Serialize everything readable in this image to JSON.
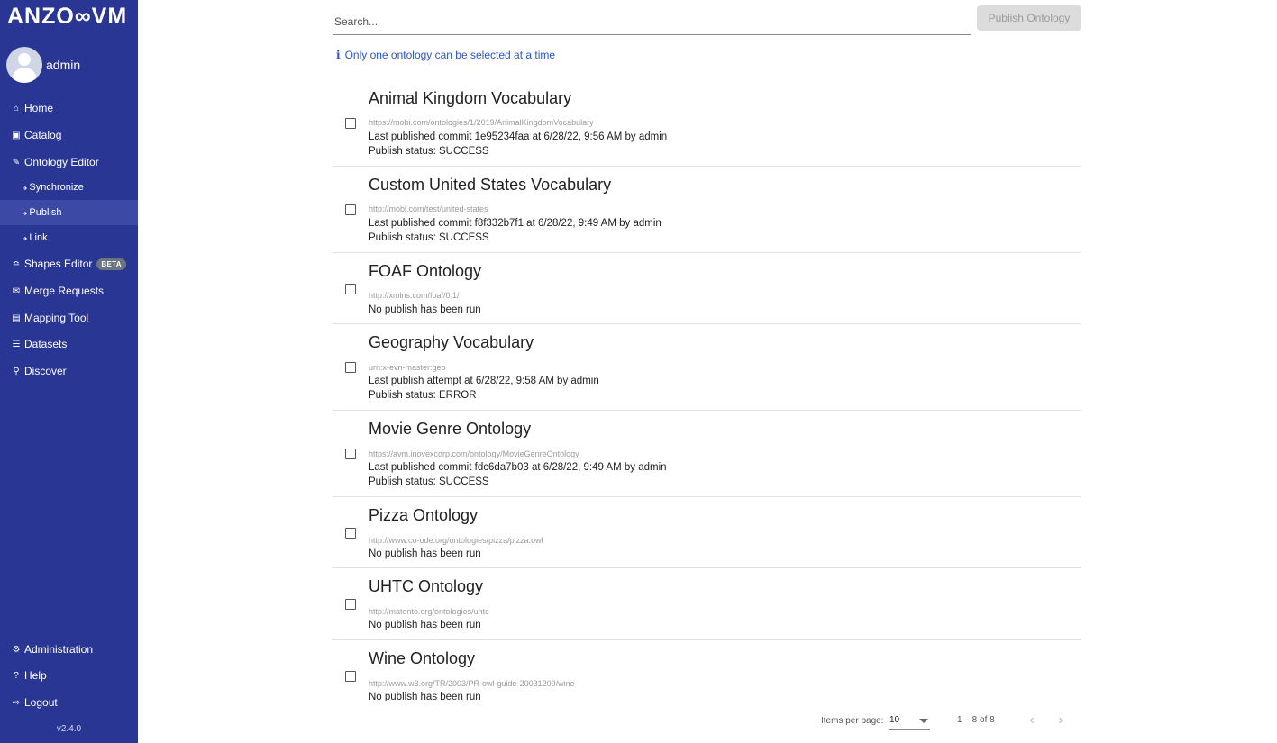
{
  "app": {
    "logo_text": "ANZO∞VM",
    "username": "admin",
    "version": "v2.4.0"
  },
  "nav": {
    "home": {
      "icon": "home-icon",
      "label": "Home"
    },
    "catalog": {
      "icon": "book-icon",
      "label": "Catalog"
    },
    "ontology_editor": {
      "icon": "edit-icon",
      "label": "Ontology Editor"
    },
    "synchronize": {
      "icon": "subitem-arrow-icon",
      "label": "Synchronize"
    },
    "publish": {
      "icon": "subitem-arrow-icon",
      "label": "Publish"
    },
    "link": {
      "icon": "subitem-arrow-icon",
      "label": "Link"
    },
    "shapes_editor": {
      "icon": "shapes-icon",
      "label": "Shapes Editor",
      "badge": "BETA"
    },
    "merge_requests": {
      "icon": "envelope-icon",
      "label": "Merge Requests"
    },
    "mapping_tool": {
      "icon": "map-icon",
      "label": "Mapping Tool"
    },
    "datasets": {
      "icon": "database-icon",
      "label": "Datasets"
    },
    "discover": {
      "icon": "search-icon",
      "label": "Discover"
    },
    "administration": {
      "icon": "gear-icon",
      "label": "Administration"
    },
    "help": {
      "icon": "question-icon",
      "label": "Help"
    },
    "logout": {
      "icon": "sign-out-icon",
      "label": "Logout"
    }
  },
  "toolbar": {
    "search_placeholder": "Search...",
    "publish_label": "Publish Ontology"
  },
  "info": {
    "icon": "info-icon",
    "text": "Only one ontology can be selected at a time"
  },
  "ontologies": [
    {
      "title": "Animal Kingdom Vocabulary",
      "iri": "https://mobi.com/ontologies/1/2019/AnimalKingdomVocabulary",
      "line1": "Last published commit ",
      "commit": "1e95234faa",
      "line1_mid": " at 6/28/22, 9:56 AM by ",
      "user": "admin",
      "status_prefix": "Publish status: ",
      "status": "SUCCESS"
    },
    {
      "title": "Custom United States Vocabulary",
      "iri": "http://mobi.com/test/united-states",
      "line1": "Last published commit ",
      "commit": "f8f332b7f1",
      "line1_mid": " at 6/28/22, 9:49 AM by ",
      "user": "admin",
      "status_prefix": "Publish status: ",
      "status": "SUCCESS"
    },
    {
      "title": "FOAF Ontology",
      "iri": "http://xmlns.com/foaf/0.1/",
      "no_publish": "No publish has been run"
    },
    {
      "title": "Geography Vocabulary",
      "iri": "urn:x-evn-master:geo",
      "line1": "Last publish attempt at 6/28/22, 9:58 AM by ",
      "user": "admin",
      "status_prefix": "Publish status: ",
      "status": "ERROR"
    },
    {
      "title": "Movie Genre Ontology",
      "iri": "https://avm.inovexcorp.com/ontology/MovieGenreOntology",
      "line1": "Last published commit ",
      "commit": "fdc6da7b03",
      "line1_mid": " at 6/28/22, 9:49 AM by ",
      "user": "admin",
      "status_prefix": "Publish status: ",
      "status": "SUCCESS"
    },
    {
      "title": "Pizza Ontology",
      "iri": "http://www.co-ode.org/ontologies/pizza/pizza.owl",
      "no_publish": "No publish has been run"
    },
    {
      "title": "UHTC Ontology",
      "iri": "http://matonto.org/ontologies/uhtc",
      "no_publish": "No publish has been run"
    },
    {
      "title": "Wine Ontology",
      "iri": "http://www.w3.org/TR/2003/PR-owl-guide-20031209/wine",
      "no_publish": "No publish has been run"
    }
  ],
  "paginator": {
    "items_per_page_label": "Items per page:",
    "items_per_page": "10",
    "range": "1 – 8 of 8",
    "prev_icon": "chevron-left-icon",
    "next_icon": "chevron-right-icon"
  }
}
